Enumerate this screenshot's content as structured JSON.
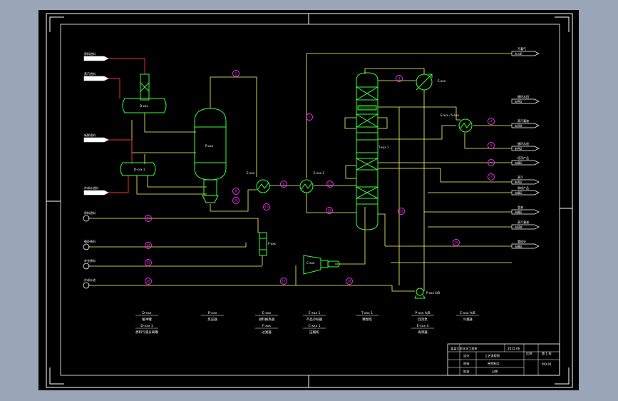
{
  "colors": {
    "background": "#9aa5b8",
    "canvas": "#000000",
    "frame": "#ffffff",
    "equipment": "#39ff39",
    "process_line": "#ffff66",
    "utility_line": "#ff3030",
    "tag_circle": "#ff33ff",
    "text": "#ffffff"
  },
  "left_streams": [
    {
      "name": "inlet-1",
      "label": "原料进料"
    },
    {
      "name": "inlet-2",
      "label": "蒸汽进料"
    },
    {
      "name": "inlet-3",
      "label": "新鲜进料"
    },
    {
      "name": "inlet-4",
      "label": "冷却水进料"
    }
  ],
  "left_feeds": [
    {
      "name": "feed-1",
      "label": "原料进料"
    },
    {
      "name": "feed-2",
      "label": "循环原料"
    },
    {
      "name": "feed-3",
      "label": "补充原料"
    },
    {
      "name": "feed-4",
      "label": "冷却水进"
    }
  ],
  "right_products": [
    {
      "name": "product-1",
      "label": "不凝气",
      "tag": "去火炬"
    },
    {
      "name": "product-2",
      "label": "循环水回",
      "tag": "去界区"
    },
    {
      "name": "product-3",
      "label": "蒸汽凝液",
      "tag": "去回收"
    },
    {
      "name": "product-4",
      "label": "循环水进",
      "tag": "来界区"
    },
    {
      "name": "product-5",
      "label": "塔顶产品",
      "tag": "去罐区"
    },
    {
      "name": "product-6",
      "label": "蒸汽",
      "tag": "来界区"
    },
    {
      "name": "product-7",
      "label": "侧线产品",
      "tag": "去罐区"
    },
    {
      "name": "product-8",
      "label": "釜液",
      "tag": "去罐区"
    },
    {
      "name": "product-9",
      "label": "蒸汽凝液",
      "tag": "去回收"
    },
    {
      "name": "product-10",
      "label": "重组分",
      "tag": "去罐区"
    }
  ],
  "equipment_tags": {
    "drum_top": "D-xxx",
    "reactor": "R-xxx",
    "drum_bottom": "D-xxx 1",
    "exchanger_1": "E-xxx",
    "exchanger_2": "E-xxx 1",
    "column": "T-xxx 1",
    "condenser": "E-xxx",
    "reboiler": "E-xxx / V-xxx",
    "filter": "F-xxx",
    "compressor": "C-xxx",
    "pump": "P-xxx A/B"
  },
  "tag_circles": [
    "1",
    "2",
    "3",
    "4",
    "5",
    "6",
    "7",
    "8",
    "9",
    "10",
    "11",
    "12",
    "13",
    "14",
    "15",
    "16",
    "17",
    "18",
    "19",
    "20",
    "21"
  ],
  "legend": [
    {
      "tag": "D-xxx",
      "desc": "缓冲罐",
      "tag2": "D-xxx 1",
      "desc2": "原料气液分离罐"
    },
    {
      "tag": "R-xxx",
      "desc": "反应器"
    },
    {
      "tag": "E-xxx",
      "desc": "进料换热器",
      "tag2": "F-xxx",
      "desc2": "过滤器"
    },
    {
      "tag": "E-xxx 1",
      "desc": "产品冷却器",
      "tag2": "C-xxx 1",
      "desc2": "压缩机"
    },
    {
      "tag": "T-xxx 1",
      "desc": "精馏塔"
    },
    {
      "tag": "P-xxx A/B",
      "desc": "回流泵",
      "tag2": "E-xxx 4",
      "desc2": "再沸器"
    },
    {
      "tag": "E-xxx A/B",
      "desc": "冷凝器"
    }
  ],
  "title_block": {
    "school": "某某大学化学工程系",
    "year": "2015.06",
    "drawing_title": "工艺流程图",
    "subtitle": "带控制点",
    "scale": "比例",
    "sheet": "第 1 张",
    "designer": "设计",
    "checker": "审核",
    "drawing_no": "PID-01",
    "approver": "批准",
    "date": "日期"
  }
}
